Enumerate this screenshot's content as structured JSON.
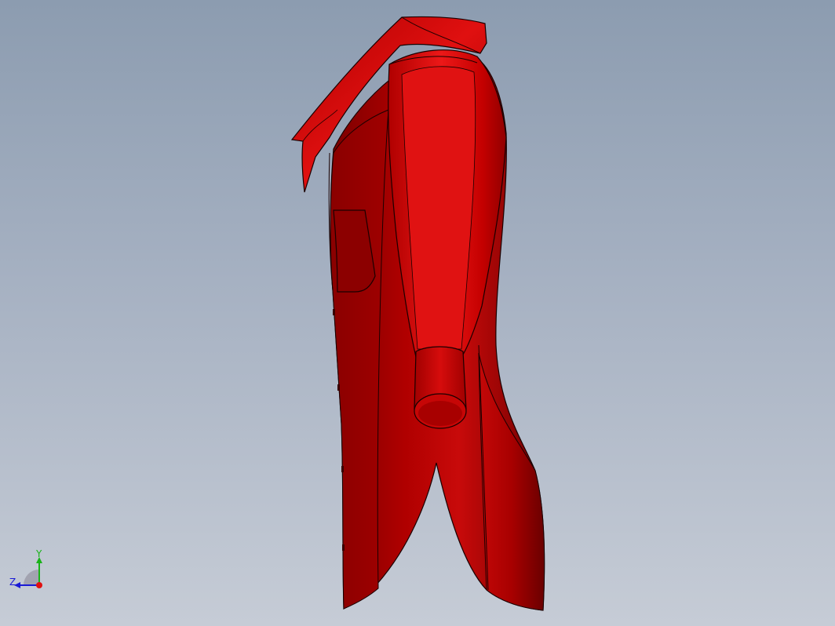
{
  "viewport": {
    "background_top": "#8c9cb0",
    "background_bottom": "#c6ccd6"
  },
  "model": {
    "name": "coat",
    "base_color": "#c00000",
    "highlight_color": "#e81414",
    "shadow_color": "#6e0000",
    "edge_color": "#000000"
  },
  "triad": {
    "y_label": "Y",
    "z_label": "Z",
    "y_color": "#19b319",
    "z_color": "#1a1ad6",
    "x_color": "#e01010"
  }
}
